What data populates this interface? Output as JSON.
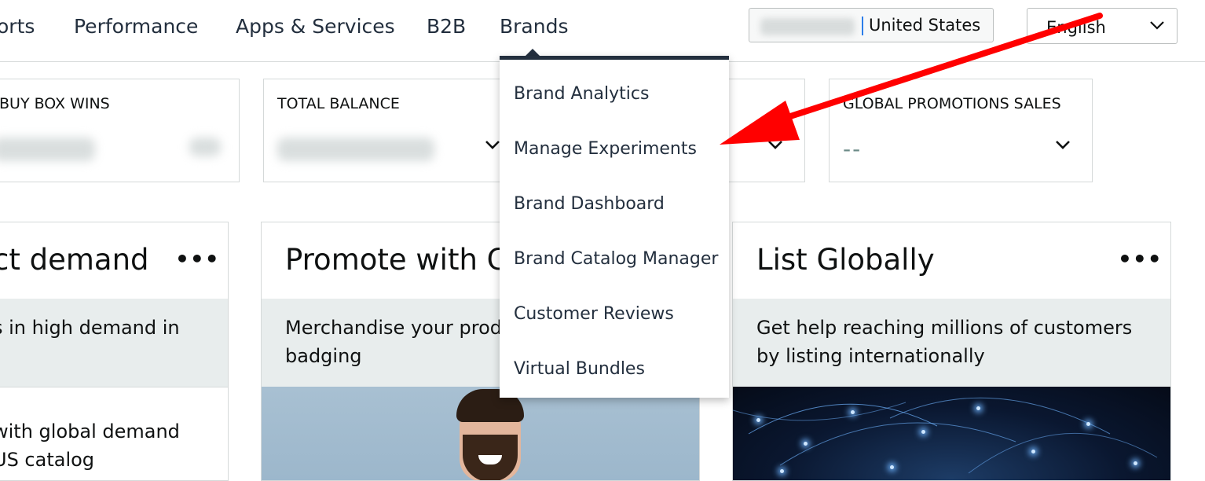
{
  "nav": {
    "items": [
      "orts",
      "Performance",
      "Apps & Services",
      "B2B",
      "Brands"
    ],
    "marketplace": "United States",
    "language": "English"
  },
  "kpis": [
    {
      "title": "BUY BOX WINS"
    },
    {
      "title": "TOTAL BALANCE"
    },
    {
      "title": "GLOBAL PROMOTIONS SALES",
      "value": "--"
    }
  ],
  "cards": [
    {
      "title": "ct demand",
      "description": "s in high demand in",
      "body": "with global demand\nUS catalog"
    },
    {
      "title": "Promote with C",
      "description": "Merchandise your produ\nbadging"
    },
    {
      "title": "List Globally",
      "description": "Get help reaching millions of customers\nby listing internationally"
    }
  ],
  "dropdown": {
    "items": [
      "Brand Analytics",
      "Manage Experiments",
      "Brand Dashboard",
      "Brand Catalog Manager",
      "Customer Reviews",
      "Virtual Bundles"
    ]
  },
  "icons": {
    "chevron": "chevron-down-icon",
    "more": "more-options-icon",
    "annotation": "red-arrow-annotation"
  },
  "colors": {
    "nav_text": "#232f3e",
    "band": "#e8eded",
    "arrow": "#ff0000"
  }
}
